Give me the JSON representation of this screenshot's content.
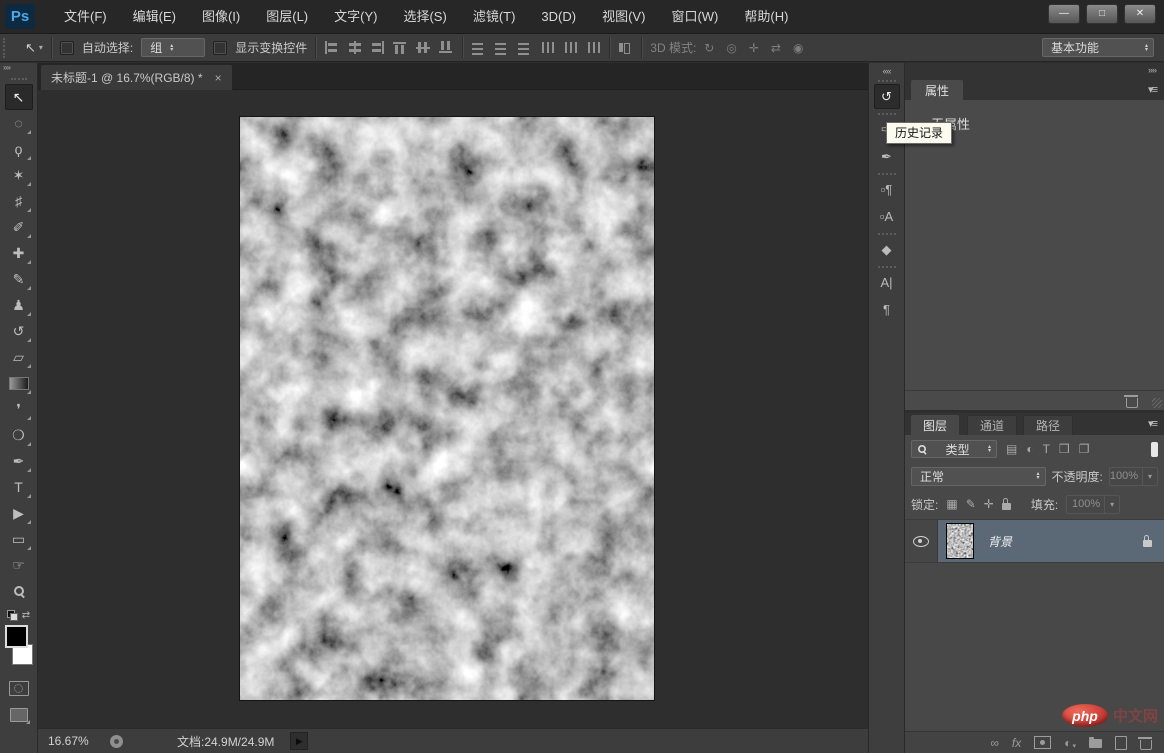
{
  "app": {
    "logo": "Ps"
  },
  "menubar": {
    "items": [
      "文件(F)",
      "编辑(E)",
      "图像(I)",
      "图层(L)",
      "文字(Y)",
      "选择(S)",
      "滤镜(T)",
      "3D(D)",
      "视图(V)",
      "窗口(W)",
      "帮助(H)"
    ]
  },
  "options": {
    "auto_select_label": "自动选择:",
    "auto_select_value": "组",
    "show_transform_label": "显示变换控件",
    "mode3d_label": "3D 模式:",
    "workspace": "基本功能"
  },
  "document": {
    "tab_title": "未标题-1 @ 16.7%(RGB/8) *",
    "close_glyph": "×"
  },
  "statusbar": {
    "zoom": "16.67%",
    "doc_label": "文档:24.9M/24.9M"
  },
  "tooltip": {
    "text": "历史记录"
  },
  "properties_panel": {
    "tab": "属性",
    "empty_text": "无属性"
  },
  "layers_panel": {
    "tabs": [
      "图层",
      "通道",
      "路径"
    ],
    "filter_label": "类型",
    "blend_mode": "正常",
    "opacity_label": "不透明度:",
    "opacity_value": "100%",
    "lock_label": "锁定:",
    "fill_label": "填充:",
    "fill_value": "100%",
    "layer": {
      "name": "背景",
      "visible": true,
      "locked": true
    }
  },
  "watermark": {
    "brand": "php",
    "suffix": "中文网"
  },
  "colors": {
    "ui_bg": "#3c3c3c",
    "panel_bg": "#484848",
    "canvas_bg": "#2e2e2e",
    "selected_layer_row": "#5b6977",
    "logo_blue": "#4aa9e8",
    "tooltip_bg": "#fbfbf0",
    "watermark_red": "#b01f1f"
  },
  "icons": {
    "window_minimize": "—",
    "window_maximize": "□",
    "window_close": "✕",
    "move": "↖",
    "marquee": "◌",
    "lasso": "ϙ",
    "magic_wand": "✶",
    "crop": "♯",
    "eyedropper": "✐",
    "healing_brush": "✚",
    "brush": "✎",
    "clone_stamp": "♟",
    "history_brush": "↺",
    "eraser": "▱",
    "gradient": "css:gradient-rect",
    "blur": "❜",
    "dodge": "❍",
    "pen": "✒",
    "type": "T",
    "path_select": "▶",
    "shape": "▭",
    "hand": "☞",
    "zoom_tool": "css:magnifier",
    "swap_colors": "⇄",
    "toolbar_expand": "»»",
    "dock_collapse": "««",
    "panel_expand": "»»",
    "dock_history": "↺",
    "dock_brush": "✑",
    "dock_brush_presets": "✒",
    "dock_paragraph_styles": "▫¶",
    "dock_character_styles": "▫A",
    "dock_3d": "◆",
    "dock_character": "A|",
    "dock_paragraph": "¶",
    "panel_menu": "▾≡",
    "dropdown_caret": "▾",
    "spinner_up": "▴",
    "spinner_down": "▾",
    "mode3d": [
      "↻",
      "◎",
      "✛",
      "⇄",
      "◉"
    ],
    "filter_image": "▤",
    "filter_adjust": "◐",
    "filter_type": "T",
    "filter_shape": "❒",
    "filter_smart": "❐",
    "lock_transparency": "▦",
    "lock_paint": "✎",
    "lock_position": "✛",
    "status_arrow": "▶",
    "link_layers": "∞",
    "layer_fx": "fx",
    "adjustment_layer": "◐"
  }
}
